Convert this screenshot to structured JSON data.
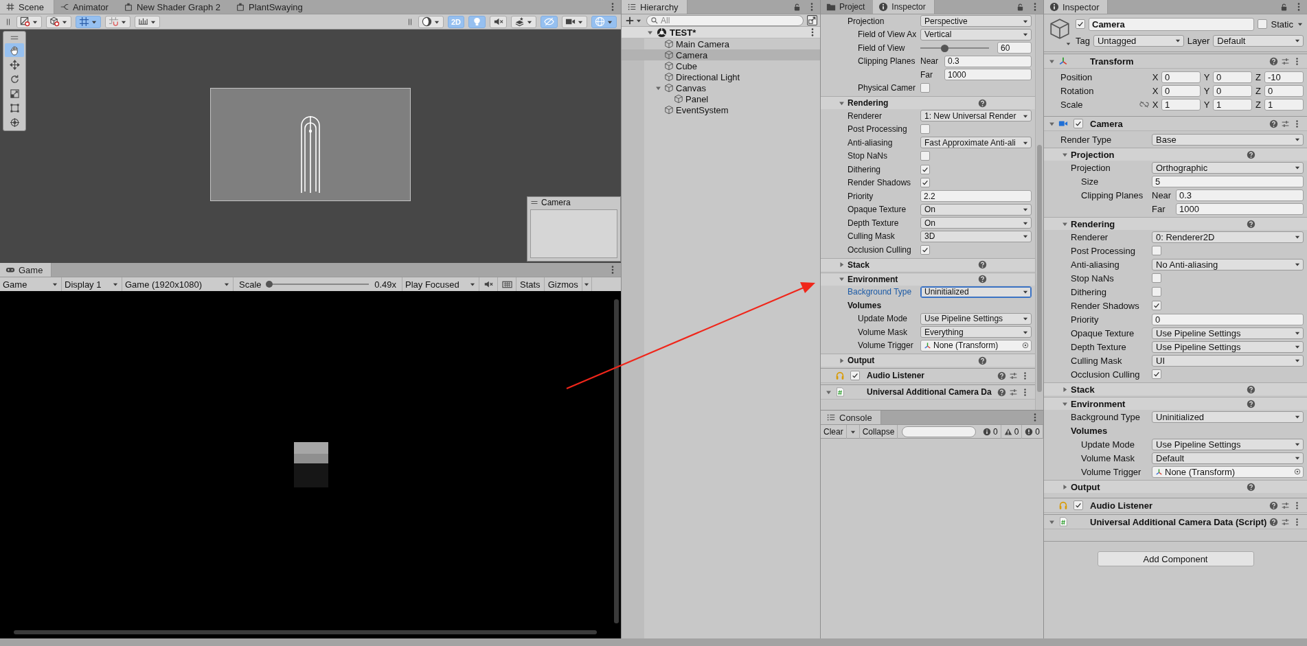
{
  "scene_panel": {
    "tabs": [
      {
        "kind": "scene",
        "label": "Scene",
        "selected": true
      },
      {
        "kind": "animator",
        "label": "Animator",
        "selected": false
      },
      {
        "kind": "shader",
        "label": "New Shader Graph 2",
        "selected": false
      },
      {
        "kind": "shader",
        "label": "PlantSwaying",
        "selected": false
      }
    ],
    "toolbar_left": [
      {
        "kind": "draw_mode",
        "on": false
      },
      {
        "kind": "render_mode",
        "on": false
      },
      {
        "kind": "grid_snap",
        "on": true
      },
      {
        "kind": "increment_snap",
        "on": false
      },
      {
        "kind": "grid",
        "on": false
      }
    ],
    "toolbar_right": [
      {
        "kind": "shading",
        "on": false
      },
      {
        "kind": "dimension",
        "label": "2D",
        "on": true
      },
      {
        "kind": "lighting",
        "on": true
      },
      {
        "kind": "audio",
        "on": false
      },
      {
        "kind": "effects",
        "on": false
      },
      {
        "kind": "visibility",
        "on": true
      },
      {
        "kind": "camera",
        "on": false
      },
      {
        "kind": "gizmos",
        "on": true
      }
    ],
    "tools": [
      {
        "kind": "hand",
        "selected": true
      },
      {
        "kind": "move",
        "selected": false
      },
      {
        "kind": "rotate",
        "selected": false
      },
      {
        "kind": "scale",
        "selected": false
      },
      {
        "kind": "rect",
        "selected": false
      },
      {
        "kind": "transform",
        "selected": false
      }
    ],
    "camera_preview": {
      "title": "Camera"
    }
  },
  "game_panel": {
    "tab": "Game",
    "view_mode": "Game",
    "display": "Display 1",
    "resolution": "Game (1920x1080)",
    "scale_label": "Scale",
    "scale": {
      "level": 0.02
    },
    "scale_reading": "0.49x",
    "play_mode": "Play Focused",
    "stats": "Stats",
    "gizmos": "Gizmos"
  },
  "hierarchy": {
    "title": "Hierarchy",
    "search": {
      "placeholder": "All"
    },
    "scene": {
      "name": "TEST*",
      "expanded": true,
      "children": [
        {
          "name": "Main Camera",
          "selected": false
        },
        {
          "name": "Camera",
          "selected": true
        },
        {
          "name": "Cube",
          "selected": false
        },
        {
          "name": "Directional Light",
          "selected": false
        },
        {
          "name": "Canvas",
          "selected": false,
          "expanded": true,
          "children": [
            {
              "name": "Panel",
              "selected": false
            }
          ]
        },
        {
          "name": "EventSystem",
          "selected": false
        }
      ]
    }
  },
  "inspector_center": {
    "tabs": [
      {
        "kind": "project",
        "label": "Project",
        "selected": false
      },
      {
        "kind": "inspector",
        "label": "Inspector",
        "selected": true
      }
    ],
    "rows": [
      {
        "kind": "section",
        "rows": [
          {
            "kind": "dropdown",
            "label": "Projection",
            "value": "Perspective",
            "rows": [
              {
                "kind": "dropdown",
                "label": "Field of View Ax",
                "value": "Vertical"
              },
              {
                "kind": "slider",
                "label": "Field of View",
                "level": 0.35,
                "value": "60"
              },
              {
                "kind": "subfield",
                "label": "Clipping Planes",
                "sublabel": "Near",
                "value": "0.3"
              },
              {
                "kind": "subfield",
                "sublabel": "Far",
                "value": "1000"
              },
              {
                "kind": "checkbox",
                "label": "Physical Camer",
                "checked": false
              }
            ]
          }
        ]
      },
      {
        "kind": "section",
        "label": "Rendering",
        "expanded": true,
        "rows": [
          {
            "kind": "dropdown",
            "label": "Renderer",
            "value": "1: New Universal Render"
          },
          {
            "kind": "checkbox",
            "label": "Post Processing",
            "checked": false
          },
          {
            "kind": "dropdown",
            "label": "Anti-aliasing",
            "value": "Fast Approximate Anti-ali"
          },
          {
            "kind": "checkbox",
            "label": "Stop NaNs",
            "checked": false
          },
          {
            "kind": "checkbox",
            "label": "Dithering",
            "checked": true
          },
          {
            "kind": "checkbox",
            "label": "Render Shadows",
            "checked": true
          },
          {
            "kind": "text",
            "label": "Priority",
            "value": "2.2"
          },
          {
            "kind": "dropdown",
            "label": "Opaque Texture",
            "value": "On"
          },
          {
            "kind": "dropdown",
            "label": "Depth Texture",
            "value": "On"
          },
          {
            "kind": "dropdown",
            "label": "Culling Mask",
            "value": "3D"
          },
          {
            "kind": "checkbox",
            "label": "Occlusion Culling",
            "checked": true
          }
        ]
      },
      {
        "kind": "section",
        "label": "Stack",
        "expanded": false
      },
      {
        "kind": "section",
        "label": "Environment",
        "expanded": true,
        "rows": [
          {
            "kind": "dropdown",
            "label": "Background Type",
            "value": "Uninitialized",
            "focused": true
          },
          {
            "kind": "label",
            "label": "Volumes",
            "rows": [
              {
                "kind": "dropdown",
                "label": "Update Mode",
                "value": "Use Pipeline Settings"
              },
              {
                "kind": "dropdown",
                "label": "Volume Mask",
                "value": "Everything"
              },
              {
                "kind": "object",
                "label": "Volume Trigger",
                "value": "None (Transform)"
              }
            ]
          }
        ]
      },
      {
        "kind": "section",
        "label": "Output",
        "expanded": false
      }
    ],
    "components": [
      {
        "kind": "audio",
        "name": "Audio Listener",
        "enabled": true
      },
      {
        "kind": "script",
        "name": "Universal Additional Camera Da",
        "expanded": true
      }
    ]
  },
  "console": {
    "title": "Console",
    "clear": "Clear",
    "collapse": "Collapse",
    "counts": [
      {
        "kind": "info",
        "count": "0"
      },
      {
        "kind": "warning",
        "count": "0"
      },
      {
        "kind": "error",
        "count": "0"
      }
    ]
  },
  "inspector_right": {
    "title": "Inspector",
    "object": {
      "enabled": true,
      "name": "Camera",
      "static": false,
      "static_label": "Static",
      "tag_label": "Tag",
      "tag": "Untagged",
      "layer_label": "Layer",
      "layer": "Default"
    },
    "components": [
      {
        "kind": "transform",
        "name": "Transform",
        "expanded": true,
        "rows": [
          {
            "kind": "vector",
            "label": "Position",
            "values": [
              {
                "axis": "X",
                "value": "0"
              },
              {
                "axis": "Y",
                "value": "0"
              },
              {
                "axis": "Z",
                "value": "-10"
              }
            ]
          },
          {
            "kind": "vector",
            "label": "Rotation",
            "values": [
              {
                "axis": "X",
                "value": "0"
              },
              {
                "axis": "Y",
                "value": "0"
              },
              {
                "axis": "Z",
                "value": "0"
              }
            ]
          },
          {
            "kind": "vector",
            "label": "Scale",
            "linked": false,
            "values": [
              {
                "axis": "X",
                "value": "1"
              },
              {
                "axis": "Y",
                "value": "1"
              },
              {
                "axis": "Z",
                "value": "1"
              }
            ]
          }
        ]
      },
      {
        "kind": "camera",
        "name": "Camera",
        "expanded": true,
        "enabled": true,
        "rows": [
          {
            "kind": "dropdown",
            "label": "Render Type",
            "value": "Base"
          },
          {
            "kind": "section",
            "label": "Projection",
            "expanded": true,
            "rows": [
              {
                "kind": "dropdown",
                "label": "Projection",
                "value": "Orthographic",
                "rows": [
                  {
                    "kind": "text",
                    "label": "Size",
                    "value": "5"
                  },
                  {
                    "kind": "subfield",
                    "label": "Clipping Planes",
                    "sublabel": "Near",
                    "value": "0.3"
                  },
                  {
                    "kind": "subfield",
                    "sublabel": "Far",
                    "value": "1000"
                  }
                ]
              }
            ]
          },
          {
            "kind": "section",
            "label": "Rendering",
            "expanded": true,
            "rows": [
              {
                "kind": "dropdown",
                "label": "Renderer",
                "value": "0: Renderer2D"
              },
              {
                "kind": "checkbox",
                "label": "Post Processing",
                "checked": false
              },
              {
                "kind": "dropdown",
                "label": "Anti-aliasing",
                "value": "No Anti-aliasing"
              },
              {
                "kind": "checkbox",
                "label": "Stop NaNs",
                "checked": false
              },
              {
                "kind": "checkbox",
                "label": "Dithering",
                "checked": false
              },
              {
                "kind": "checkbox",
                "label": "Render Shadows",
                "checked": true
              },
              {
                "kind": "text",
                "label": "Priority",
                "value": "0"
              },
              {
                "kind": "dropdown",
                "label": "Opaque Texture",
                "value": "Use Pipeline Settings"
              },
              {
                "kind": "dropdown",
                "label": "Depth Texture",
                "value": "Use Pipeline Settings"
              },
              {
                "kind": "dropdown",
                "label": "Culling Mask",
                "value": "UI"
              },
              {
                "kind": "checkbox",
                "label": "Occlusion Culling",
                "checked": true
              }
            ]
          },
          {
            "kind": "section",
            "label": "Stack",
            "expanded": false
          },
          {
            "kind": "section",
            "label": "Environment",
            "expanded": true,
            "rows": [
              {
                "kind": "dropdown",
                "label": "Background Type",
                "value": "Uninitialized"
              },
              {
                "kind": "label",
                "label": "Volumes",
                "rows": [
                  {
                    "kind": "dropdown",
                    "label": "Update Mode",
                    "value": "Use Pipeline Settings"
                  },
                  {
                    "kind": "dropdown",
                    "label": "Volume Mask",
                    "value": "Default"
                  },
                  {
                    "kind": "object",
                    "label": "Volume Trigger",
                    "value": "None (Transform)"
                  }
                ]
              }
            ]
          },
          {
            "kind": "section",
            "label": "Output",
            "expanded": false
          }
        ]
      },
      {
        "kind": "audio",
        "name": "Audio Listener",
        "enabled": true
      },
      {
        "kind": "script",
        "name": "Universal Additional Camera Data (Script)",
        "expanded": true
      }
    ],
    "add_component": "Add Component"
  }
}
